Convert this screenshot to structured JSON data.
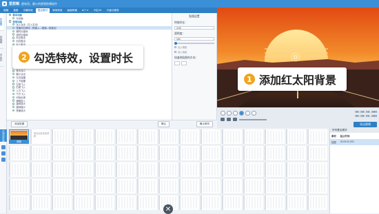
{
  "app": {
    "name": "爱剪辑",
    "subtitle": "超有用，最火的视频剪辑软件"
  },
  "menu": [
    "视频",
    "音频",
    "字幕特效",
    "叠加素材",
    "转场特效",
    "画面风格",
    "M T V",
    "卡拉OK",
    "升级与服务"
  ],
  "menu_active_index": 3,
  "left_tabs": [
    "加贴图",
    "加相框",
    "去水印"
  ],
  "effects": {
    "rows": [
      {
        "label": "基本动画",
        "type": "cat"
      },
      {
        "label": "无动画",
        "type": "item"
      },
      {
        "label": "常用动画",
        "type": "cat"
      },
      {
        "label": "淡入淡出（左入右出）",
        "type": "item"
      },
      {
        "label": "快速向左移动（快速入—慢速—快速出）",
        "type": "sel"
      },
      {
        "label": "顺时针旋转",
        "type": "item"
      },
      {
        "label": "逆时针旋转",
        "type": "item"
      },
      {
        "label": "向左推出",
        "type": "item"
      },
      {
        "label": "向右推出",
        "type": "item"
      },
      {
        "label": "向上推出",
        "type": "item"
      },
      {
        "label": "向下推出",
        "type": "item"
      },
      {
        "label": "缩放进入",
        "type": "item"
      },
      {
        "label": "缩放退出",
        "type": "item"
      },
      {
        "label": "向左滑动",
        "type": "item"
      },
      {
        "label": "向右滑动",
        "type": "item"
      },
      {
        "label": "向上滑动",
        "type": "item"
      },
      {
        "label": "向下滑动",
        "type": "item"
      },
      {
        "label": "放大淡入",
        "type": "item"
      },
      {
        "label": "缩小淡出",
        "type": "item"
      },
      {
        "label": "左右摇摆",
        "type": "item"
      },
      {
        "label": "上下摇摆",
        "type": "item"
      },
      {
        "label": "左侧飞入",
        "type": "item"
      },
      {
        "label": "右侧飞入",
        "type": "item"
      },
      {
        "label": "上方飞入",
        "type": "item"
      },
      {
        "label": "下方飞入",
        "type": "item"
      },
      {
        "label": "闪烁出现",
        "type": "item"
      },
      {
        "label": "弹跳进入",
        "type": "item"
      },
      {
        "label": "旋转放大",
        "type": "item"
      },
      {
        "label": "旋转缩小",
        "type": "item"
      },
      {
        "label": "快速放大",
        "type": "item"
      }
    ]
  },
  "bottom_buttons": {
    "add": "添加贴图",
    "confirm": "确认",
    "apply": "确认修改"
  },
  "settings": {
    "title": "贴图设置",
    "duration_label": "特效时长：",
    "duration_value": "3.00",
    "opacity_label": "透明度：",
    "opacity_value": "100",
    "check1": "加入阴影",
    "check2": "加入投影",
    "flip_label": "快速改贴图的方向："
  },
  "callouts": {
    "c1_num": "1",
    "c1_text": "添加红太阳背景",
    "c2_num": "2",
    "c2_text": "勾选特效，设置时长"
  },
  "player": {
    "time_current": "00:00:00.000",
    "time_total": "00:00:05.000",
    "export": "导出视频"
  },
  "timeline": {
    "tab": "已添加片段",
    "clip_label": "视频",
    "placeholder": "双击此处添加视频"
  },
  "props": {
    "header": "所有叠加素材",
    "col1": "素材",
    "col2": "起止时间",
    "row_name": "贴图",
    "row_time": "00:00:00.000"
  },
  "colors": {
    "accent": "#3b8fd6",
    "callout_badge": "#f0a420"
  }
}
